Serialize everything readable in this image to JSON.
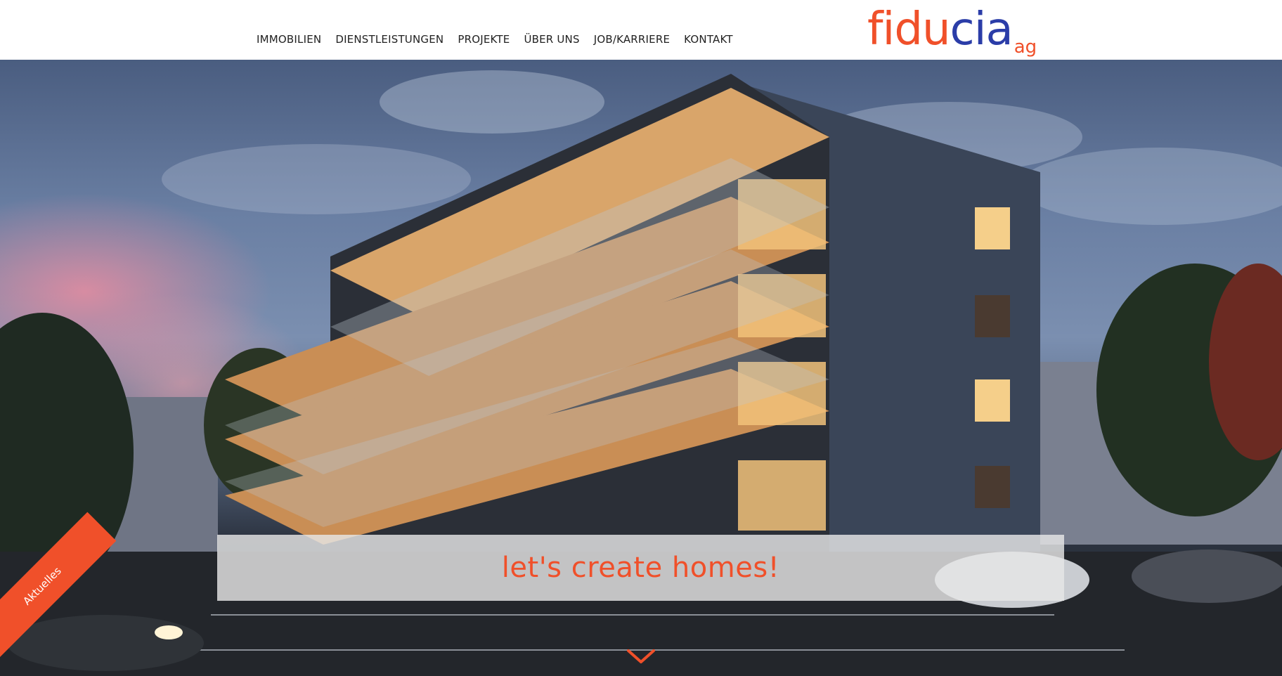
{
  "nav": {
    "items": [
      {
        "label": "IMMOBILIEN"
      },
      {
        "label": "DIENSTLEISTUNGEN"
      },
      {
        "label": "PROJEKTE"
      },
      {
        "label": "ÜBER UNS"
      },
      {
        "label": "JOB/KARRIERE"
      },
      {
        "label": "KONTAKT"
      }
    ]
  },
  "logo": {
    "part1": "fidu",
    "part2": "cia",
    "suffix": "ag",
    "color_primary": "#f0502a",
    "color_secondary": "#2b3da8"
  },
  "hero": {
    "tagline": "let's create homes!",
    "tagline_color": "#f0502a"
  },
  "ribbon": {
    "label": "Aktuelles",
    "color": "#f0502a"
  },
  "icons": {
    "scroll": "chevron-down-icon"
  }
}
